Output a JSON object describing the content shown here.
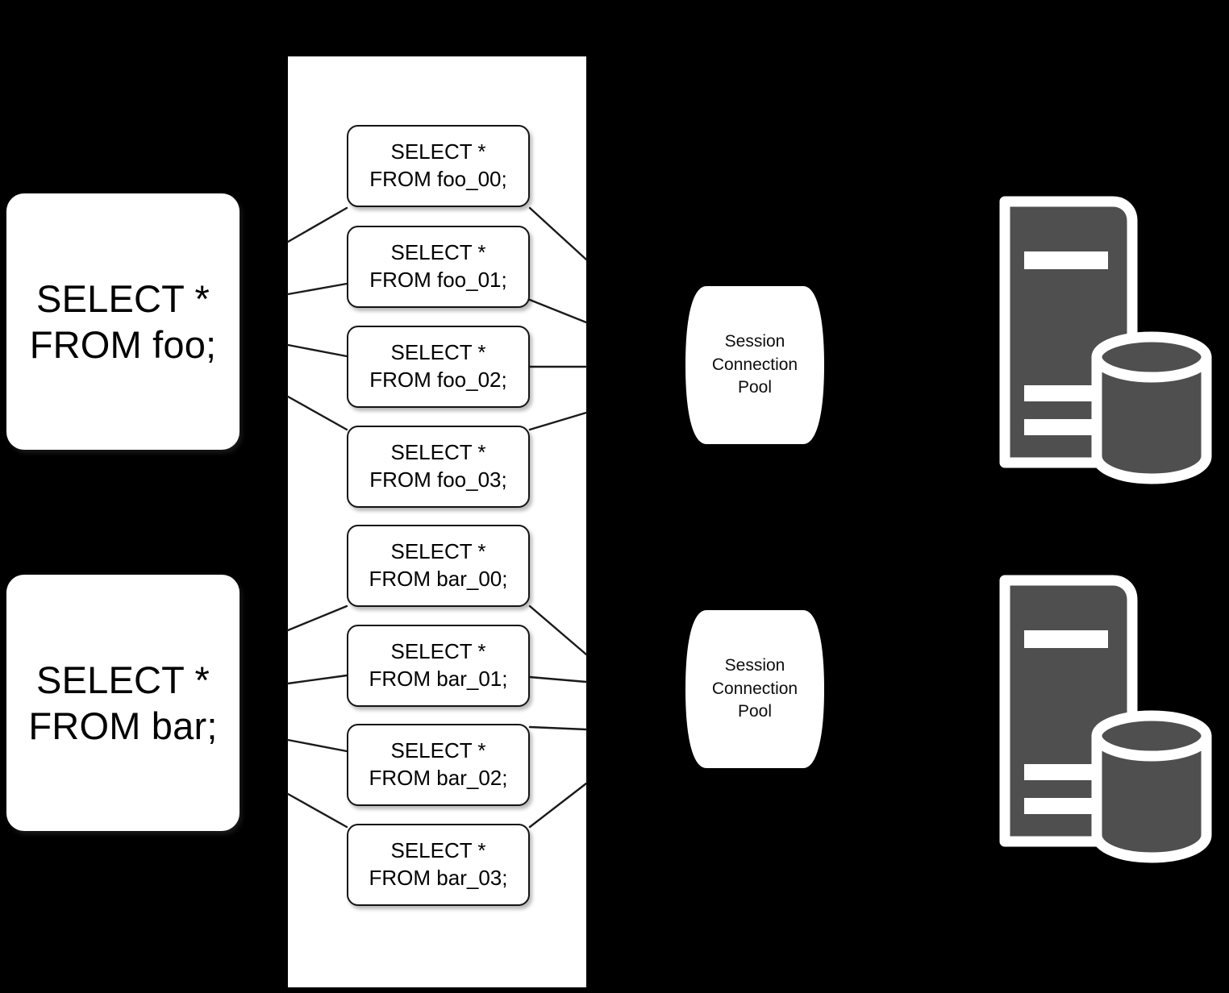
{
  "diagram": {
    "title": "SQL query sharding and routing to database shards",
    "colors": {
      "background": "#000000",
      "panel": "#ffffff",
      "box_fill": "#ffffff",
      "box_stroke": "#141414",
      "text": "#000000",
      "server_fill": "#4f4f4f",
      "server_outline": "#ffffff",
      "connector": "#1a1a1a"
    }
  },
  "clients": [
    {
      "name": "client-query-foo",
      "text": "SELECT *\nFROM foo;"
    },
    {
      "name": "client-query-bar",
      "text": "SELECT *\nFROM bar;"
    }
  ],
  "router": {
    "name": "query-router-panel",
    "shards": [
      {
        "group": "foo",
        "index": 0,
        "text": "SELECT *\nFROM foo_00;"
      },
      {
        "group": "foo",
        "index": 1,
        "text": "SELECT *\nFROM foo_01;"
      },
      {
        "group": "foo",
        "index": 2,
        "text": "SELECT *\nFROM foo_02;"
      },
      {
        "group": "foo",
        "index": 3,
        "text": "SELECT *\nFROM foo_03;"
      },
      {
        "group": "bar",
        "index": 0,
        "text": "SELECT *\nFROM bar_00;"
      },
      {
        "group": "bar",
        "index": 1,
        "text": "SELECT *\nFROM bar_01;"
      },
      {
        "group": "bar",
        "index": 2,
        "text": "SELECT *\nFROM bar_02;"
      },
      {
        "group": "bar",
        "index": 3,
        "text": "SELECT *\nFROM bar_03;"
      }
    ]
  },
  "pools": [
    {
      "name": "session-connection-pool-top",
      "text": "Session\nConnection\nPool"
    },
    {
      "name": "session-connection-pool-bottom",
      "text": "Session\nConnection\nPool"
    }
  ],
  "databases": [
    {
      "name": "database-server-top",
      "icon": "database-server-icon"
    },
    {
      "name": "database-server-bottom",
      "icon": "database-server-icon"
    }
  ]
}
